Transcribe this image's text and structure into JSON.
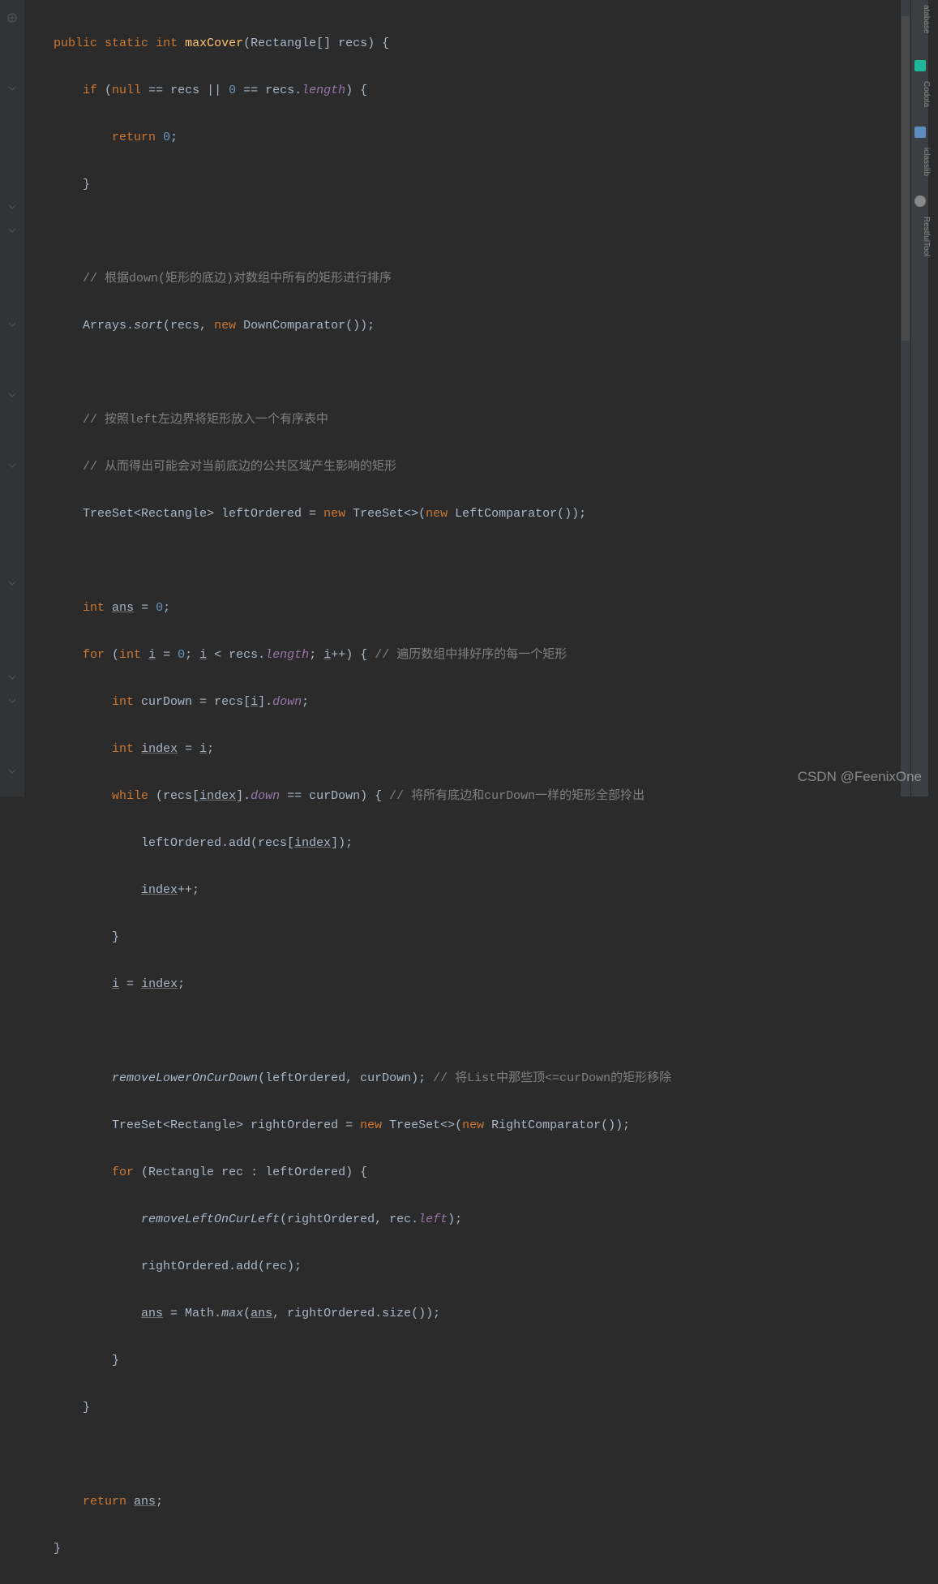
{
  "sidebar": {
    "items": [
      "atabase",
      "Codota",
      "iclasslib",
      "RestfulTool"
    ]
  },
  "watermark": "CSDN @FeenixOne",
  "code": {
    "l1": {
      "kw_public": "public",
      "kw_static": "static",
      "kw_int": "int",
      "method": "maxCover",
      "params": "(Rectangle[] recs) {"
    },
    "l2": {
      "kw_if": "if",
      "open": " (",
      "kw_null": "null",
      "eq1": " == recs || ",
      "zero": "0",
      "eq2": " == recs.",
      "len": "length",
      "close": ") {"
    },
    "l3": {
      "kw_return": "return",
      "sp": " ",
      "zero": "0",
      "semi": ";"
    },
    "l4": {
      "brace": "}"
    },
    "l6": {
      "comment": "// 根据down(矩形的底边)对数组中所有的矩形进行排序"
    },
    "l7": {
      "cls": "Arrays.",
      "sort": "sort",
      "open": "(recs, ",
      "kw_new": "new",
      "rest": " DownComparator());"
    },
    "l9": {
      "comment": "// 按照left左边界将矩形放入一个有序表中"
    },
    "l10": {
      "comment": "// 从而得出可能会对当前底边的公共区域产生影响的矩形"
    },
    "l11": {
      "p1": "TreeSet<Rectangle> leftOrdered = ",
      "kw_new1": "new",
      "p2": " TreeSet<>(",
      "kw_new2": "new",
      "p3": " LeftComparator());"
    },
    "l13": {
      "kw_int": "int",
      "sp": " ",
      "ans": "ans",
      "eq": " = ",
      "zero": "0",
      "semi": ";"
    },
    "l14": {
      "kw_for": "for",
      "open": " (",
      "kw_int": "int",
      "sp": " ",
      "i1": "i",
      "eq": " = ",
      "zero": "0",
      "semi1": "; ",
      "i2": "i",
      "lt": " < recs.",
      "len": "length",
      "semi2": "; ",
      "i3": "i",
      "inc": "++) { ",
      "comment": "// 遍历数组中排好序的每一个矩形"
    },
    "l15": {
      "kw_int": "int",
      "p1": " curDown = recs[",
      "i": "i",
      "p2": "].",
      "down": "down",
      "semi": ";"
    },
    "l16": {
      "kw_int": "int",
      "sp": " ",
      "index": "index",
      "eq": " = ",
      "i": "i",
      "semi": ";"
    },
    "l17": {
      "kw_while": "while",
      "open": " (recs[",
      "index": "index",
      "p1": "].",
      "down": "down",
      "p2": " == curDown) { ",
      "comment": "// 将所有底边和curDown一样的矩形全部拎出"
    },
    "l18": {
      "p1": "leftOrdered.add(recs[",
      "index": "index",
      "p2": "]);"
    },
    "l19": {
      "index": "index",
      "inc": "++;"
    },
    "l20": {
      "brace": "}"
    },
    "l21": {
      "i": "i",
      "eq": " = ",
      "index": "index",
      "semi": ";"
    },
    "l23": {
      "method": "removeLowerOnCurDown",
      "args": "(leftOrdered, curDown); ",
      "comment": "// 将List中那些顶<=curDown的矩形移除"
    },
    "l24": {
      "p1": "TreeSet<Rectangle> rightOrdered = ",
      "kw_new1": "new",
      "p2": " TreeSet<>(",
      "kw_new2": "new",
      "p3": " RightComparator());"
    },
    "l25": {
      "kw_for": "for",
      "rest": " (Rectangle rec : leftOrdered) {"
    },
    "l26": {
      "method": "removeLeftOnCurLeft",
      "open": "(rightOrdered, rec.",
      "left": "left",
      "close": ");"
    },
    "l27": {
      "text": "rightOrdered.add(rec);"
    },
    "l28": {
      "ans1": "ans",
      "p1": " = Math.",
      "max": "max",
      "open": "(",
      "ans2": "ans",
      "p2": ", rightOrdered.size());"
    },
    "l29": {
      "brace": "}"
    },
    "l30": {
      "brace": "}"
    },
    "l32": {
      "kw_return": "return",
      "sp": " ",
      "ans": "ans",
      "semi": ";"
    },
    "l33": {
      "brace": "}"
    }
  }
}
